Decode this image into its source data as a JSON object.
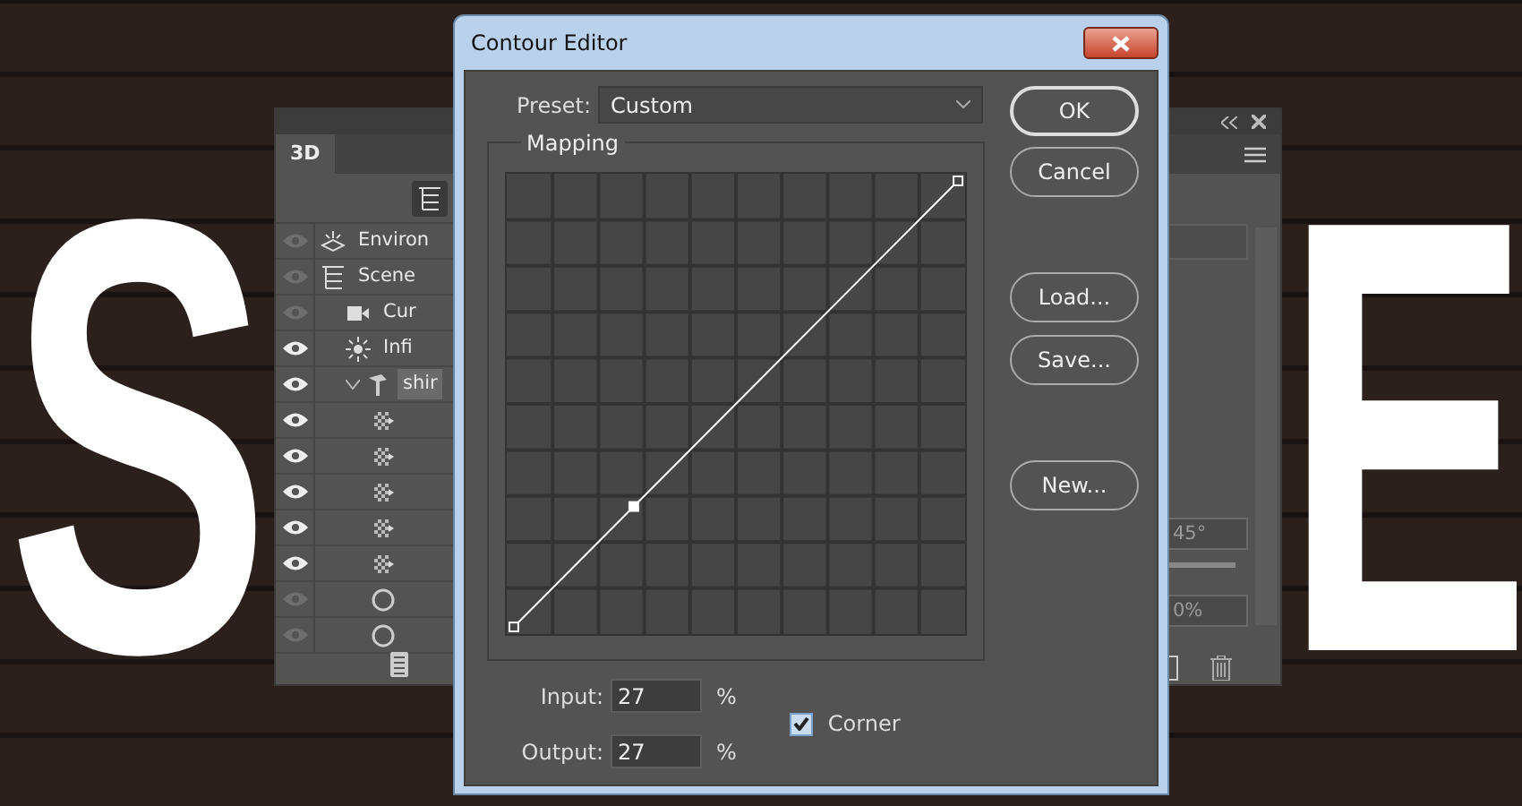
{
  "canvas_letters": [
    "S",
    "E"
  ],
  "panel_3d": {
    "tab": "3D",
    "layers": [
      {
        "label": "Environ",
        "kind": "environment",
        "visible": false,
        "selected": false
      },
      {
        "label": "Scene",
        "kind": "scene",
        "visible": false,
        "selected": false,
        "children": [
          {
            "label": "Cur",
            "kind": "camera",
            "visible": false,
            "selected": false
          },
          {
            "label": "Infi",
            "kind": "light",
            "visible": true,
            "selected": false
          },
          {
            "label": "shir",
            "kind": "mesh",
            "visible": true,
            "selected": true,
            "expanded": true,
            "children": [
              {
                "kind": "material",
                "visible": true,
                "selected": false
              },
              {
                "kind": "material",
                "visible": true,
                "selected": false
              },
              {
                "kind": "material",
                "visible": true,
                "selected": false
              },
              {
                "kind": "material",
                "visible": true,
                "selected": false
              },
              {
                "kind": "material",
                "visible": true,
                "selected": false
              },
              {
                "kind": "ring",
                "visible": false,
                "selected": false
              },
              {
                "kind": "ring",
                "visible": false,
                "selected": false
              }
            ]
          }
        ]
      }
    ],
    "fields": [
      "45°",
      "0%"
    ]
  },
  "dialog": {
    "title": "Contour Editor",
    "preset_label": "Preset:",
    "preset_value": "Custom",
    "mapping_label": "Mapping",
    "input_label": "Input:",
    "input_value": "27",
    "output_label": "Output:",
    "output_value": "27",
    "unit_input": "%",
    "unit_output": "%",
    "corner": {
      "label": "Corner",
      "checked": true
    },
    "buttons": [
      {
        "label": "OK",
        "default": true
      },
      {
        "label": "Cancel",
        "default": false
      },
      {
        "label": "Load...",
        "default": false
      },
      {
        "label": "Save...",
        "default": false
      },
      {
        "label": "New...",
        "default": false
      }
    ]
  }
}
